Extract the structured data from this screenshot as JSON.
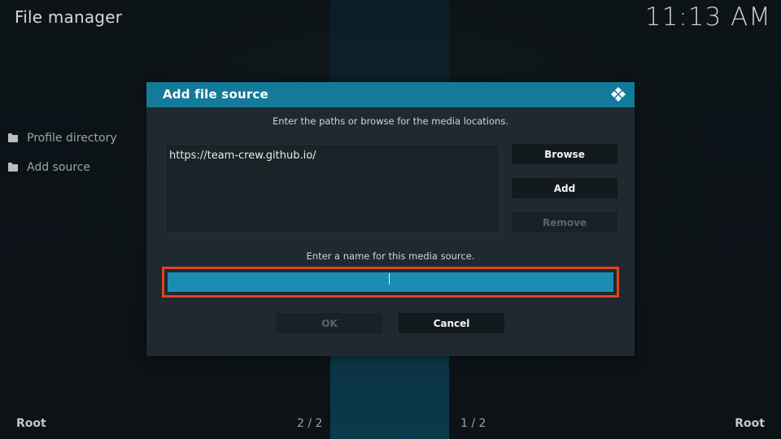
{
  "header": {
    "title": "File manager",
    "clock": "11:13 AM"
  },
  "sidebar": {
    "items": [
      {
        "label": "Profile directory"
      },
      {
        "label": "Add source"
      }
    ]
  },
  "footer": {
    "left_root": "Root",
    "left_page": "2 / 2",
    "right_page": "1 / 2",
    "right_root": "Root"
  },
  "dialog": {
    "title": "Add file source",
    "paths_instruction": "Enter the paths or browse for the media locations.",
    "paths": [
      "https://team-crew.github.io/"
    ],
    "browse_label": "Browse",
    "add_label": "Add",
    "remove_label": "Remove",
    "name_instruction": "Enter a name for this media source.",
    "name_value": "",
    "ok_label": "OK",
    "cancel_label": "Cancel"
  },
  "colors": {
    "accent": "#137a9a",
    "input_fill": "#1b8db4",
    "highlight_border": "#e2421c",
    "dialog_bg": "#1e2a2f"
  }
}
